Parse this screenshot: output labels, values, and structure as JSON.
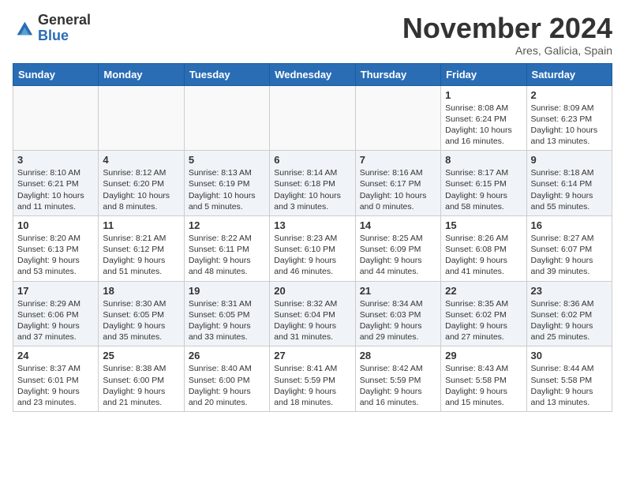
{
  "header": {
    "logo_general": "General",
    "logo_blue": "Blue",
    "month_title": "November 2024",
    "location": "Ares, Galicia, Spain"
  },
  "calendar": {
    "days_of_week": [
      "Sunday",
      "Monday",
      "Tuesday",
      "Wednesday",
      "Thursday",
      "Friday",
      "Saturday"
    ],
    "weeks": [
      [
        {
          "day": "",
          "info": ""
        },
        {
          "day": "",
          "info": ""
        },
        {
          "day": "",
          "info": ""
        },
        {
          "day": "",
          "info": ""
        },
        {
          "day": "",
          "info": ""
        },
        {
          "day": "1",
          "info": "Sunrise: 8:08 AM\nSunset: 6:24 PM\nDaylight: 10 hours and 16 minutes."
        },
        {
          "day": "2",
          "info": "Sunrise: 8:09 AM\nSunset: 6:23 PM\nDaylight: 10 hours and 13 minutes."
        }
      ],
      [
        {
          "day": "3",
          "info": "Sunrise: 8:10 AM\nSunset: 6:21 PM\nDaylight: 10 hours and 11 minutes."
        },
        {
          "day": "4",
          "info": "Sunrise: 8:12 AM\nSunset: 6:20 PM\nDaylight: 10 hours and 8 minutes."
        },
        {
          "day": "5",
          "info": "Sunrise: 8:13 AM\nSunset: 6:19 PM\nDaylight: 10 hours and 5 minutes."
        },
        {
          "day": "6",
          "info": "Sunrise: 8:14 AM\nSunset: 6:18 PM\nDaylight: 10 hours and 3 minutes."
        },
        {
          "day": "7",
          "info": "Sunrise: 8:16 AM\nSunset: 6:17 PM\nDaylight: 10 hours and 0 minutes."
        },
        {
          "day": "8",
          "info": "Sunrise: 8:17 AM\nSunset: 6:15 PM\nDaylight: 9 hours and 58 minutes."
        },
        {
          "day": "9",
          "info": "Sunrise: 8:18 AM\nSunset: 6:14 PM\nDaylight: 9 hours and 55 minutes."
        }
      ],
      [
        {
          "day": "10",
          "info": "Sunrise: 8:20 AM\nSunset: 6:13 PM\nDaylight: 9 hours and 53 minutes."
        },
        {
          "day": "11",
          "info": "Sunrise: 8:21 AM\nSunset: 6:12 PM\nDaylight: 9 hours and 51 minutes."
        },
        {
          "day": "12",
          "info": "Sunrise: 8:22 AM\nSunset: 6:11 PM\nDaylight: 9 hours and 48 minutes."
        },
        {
          "day": "13",
          "info": "Sunrise: 8:23 AM\nSunset: 6:10 PM\nDaylight: 9 hours and 46 minutes."
        },
        {
          "day": "14",
          "info": "Sunrise: 8:25 AM\nSunset: 6:09 PM\nDaylight: 9 hours and 44 minutes."
        },
        {
          "day": "15",
          "info": "Sunrise: 8:26 AM\nSunset: 6:08 PM\nDaylight: 9 hours and 41 minutes."
        },
        {
          "day": "16",
          "info": "Sunrise: 8:27 AM\nSunset: 6:07 PM\nDaylight: 9 hours and 39 minutes."
        }
      ],
      [
        {
          "day": "17",
          "info": "Sunrise: 8:29 AM\nSunset: 6:06 PM\nDaylight: 9 hours and 37 minutes."
        },
        {
          "day": "18",
          "info": "Sunrise: 8:30 AM\nSunset: 6:05 PM\nDaylight: 9 hours and 35 minutes."
        },
        {
          "day": "19",
          "info": "Sunrise: 8:31 AM\nSunset: 6:05 PM\nDaylight: 9 hours and 33 minutes."
        },
        {
          "day": "20",
          "info": "Sunrise: 8:32 AM\nSunset: 6:04 PM\nDaylight: 9 hours and 31 minutes."
        },
        {
          "day": "21",
          "info": "Sunrise: 8:34 AM\nSunset: 6:03 PM\nDaylight: 9 hours and 29 minutes."
        },
        {
          "day": "22",
          "info": "Sunrise: 8:35 AM\nSunset: 6:02 PM\nDaylight: 9 hours and 27 minutes."
        },
        {
          "day": "23",
          "info": "Sunrise: 8:36 AM\nSunset: 6:02 PM\nDaylight: 9 hours and 25 minutes."
        }
      ],
      [
        {
          "day": "24",
          "info": "Sunrise: 8:37 AM\nSunset: 6:01 PM\nDaylight: 9 hours and 23 minutes."
        },
        {
          "day": "25",
          "info": "Sunrise: 8:38 AM\nSunset: 6:00 PM\nDaylight: 9 hours and 21 minutes."
        },
        {
          "day": "26",
          "info": "Sunrise: 8:40 AM\nSunset: 6:00 PM\nDaylight: 9 hours and 20 minutes."
        },
        {
          "day": "27",
          "info": "Sunrise: 8:41 AM\nSunset: 5:59 PM\nDaylight: 9 hours and 18 minutes."
        },
        {
          "day": "28",
          "info": "Sunrise: 8:42 AM\nSunset: 5:59 PM\nDaylight: 9 hours and 16 minutes."
        },
        {
          "day": "29",
          "info": "Sunrise: 8:43 AM\nSunset: 5:58 PM\nDaylight: 9 hours and 15 minutes."
        },
        {
          "day": "30",
          "info": "Sunrise: 8:44 AM\nSunset: 5:58 PM\nDaylight: 9 hours and 13 minutes."
        }
      ]
    ]
  }
}
